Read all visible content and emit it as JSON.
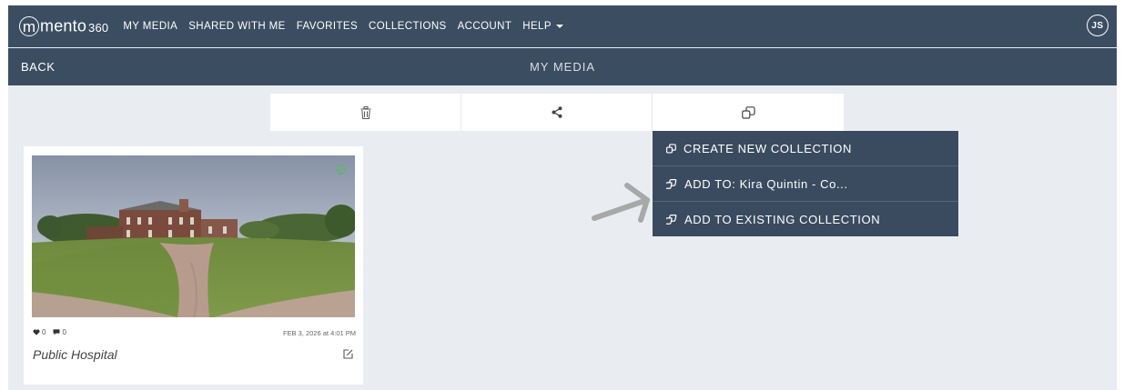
{
  "app": {
    "logo_text": "mmento",
    "logo_number": "360",
    "nav": [
      "MY MEDIA",
      "SHARED WITH ME",
      "FAVORITES",
      "COLLECTIONS",
      "ACCOUNT",
      "HELP"
    ],
    "user_initials": "JS"
  },
  "subbar": {
    "back_label": "BACK",
    "title": "MY MEDIA"
  },
  "toolbar": {
    "icons": [
      "trash-icon",
      "share-icon",
      "collection-icon"
    ]
  },
  "dropdown": {
    "items": [
      {
        "label": "CREATE NEW COLLECTION",
        "icon": "collection-icon"
      },
      {
        "label": "ADD TO: Kira Quintin - Co...",
        "icon": "add-collection-icon"
      },
      {
        "label": "ADD TO EXISTING COLLECTION",
        "icon": "add-collection-icon"
      }
    ]
  },
  "media_card": {
    "likes": "0",
    "comments": "0",
    "date": "FEB 3, 2026 at 4:01 PM",
    "title": "Public Hospital",
    "selected": true
  },
  "colors": {
    "header_bg": "#3b4d61",
    "page_bg": "#e9edf2",
    "dropdown_bg": "#3a4b60",
    "check_green": "#5cb85c"
  }
}
